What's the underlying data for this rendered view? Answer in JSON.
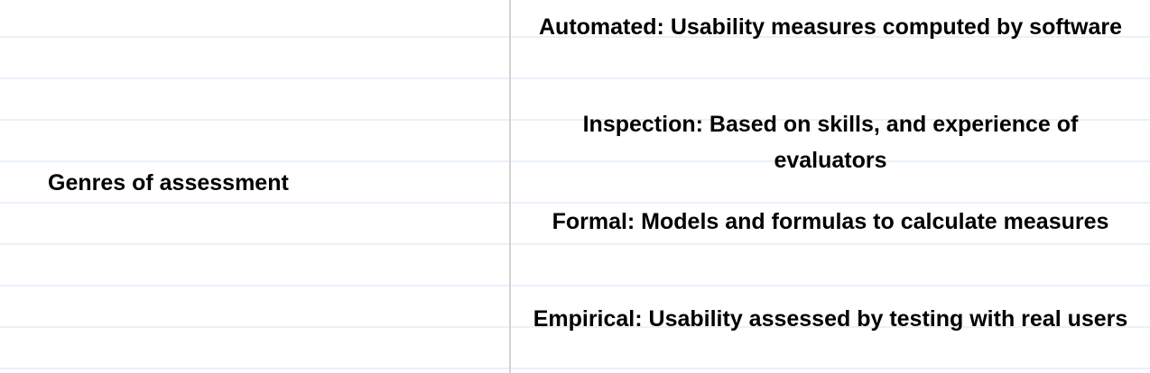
{
  "left_column": {
    "heading": "Genres of assessment"
  },
  "right_column": {
    "items": [
      {
        "text": "Automated: Usability measures computed by software"
      },
      {
        "text": "Inspection: Based on skills, and experience of evaluators"
      },
      {
        "text": "Formal: Models and formulas to calculate measures"
      },
      {
        "text": "Empirical: Usability assessed by testing with real users"
      }
    ]
  },
  "colors": {
    "background": "#ffffff",
    "text": "#000000",
    "ruled_line": "#e9f1fa",
    "divider": "#d3d3d3"
  }
}
